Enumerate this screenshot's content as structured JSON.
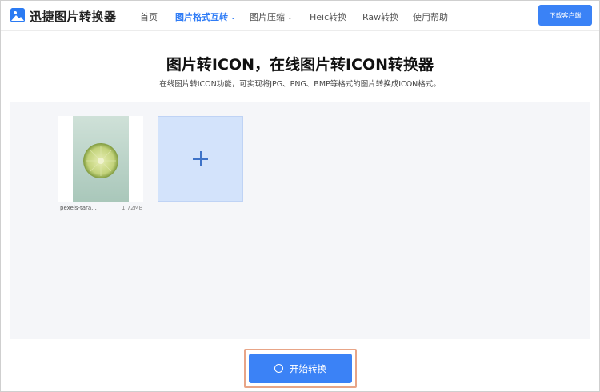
{
  "header": {
    "brand": "迅捷图片转换器",
    "nav": [
      {
        "label": "首页",
        "active": false,
        "dropdown": false
      },
      {
        "label": "图片格式互转",
        "active": true,
        "dropdown": true
      },
      {
        "label": "图片压缩",
        "active": false,
        "dropdown": true
      },
      {
        "label": "Heic转换",
        "active": false,
        "dropdown": false
      },
      {
        "label": "Raw转换",
        "active": false,
        "dropdown": false
      },
      {
        "label": "使用帮助",
        "active": false,
        "dropdown": false
      }
    ],
    "download_label": "下载客户端"
  },
  "main": {
    "title": "图片转ICON，在线图片转ICON转换器",
    "subtitle": "在线图片转ICON功能，可实现将JPG、PNG、BMP等格式的图片转换成ICON格式。"
  },
  "files": [
    {
      "name": "pexels-tara...",
      "size": "1.72MB"
    }
  ],
  "start_label": "开始转换",
  "colors": {
    "accent": "#3b82f6",
    "add_box": "#d3e3fb",
    "panel": "#f5f6f9",
    "highlight": "#e8a587"
  }
}
